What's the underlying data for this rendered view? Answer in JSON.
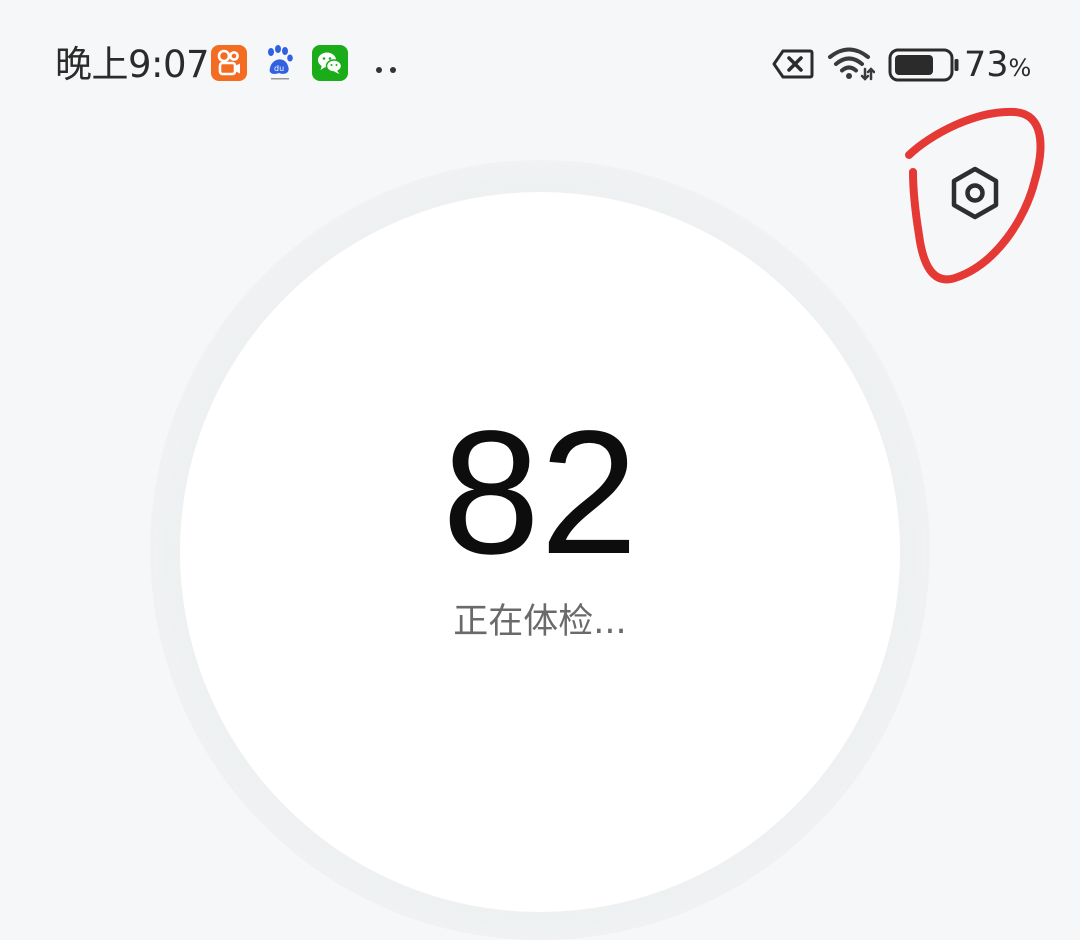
{
  "status_bar": {
    "time": "晚上9:07",
    "notification_icons": [
      "kuaishou-app-icon",
      "baidu-app-icon",
      "wechat-app-icon",
      "more-dots-icon"
    ],
    "system_icons": [
      "sim-error-icon",
      "wifi-icon",
      "battery-icon"
    ],
    "battery_level": 73,
    "battery_number": "73",
    "battery_unit": "%"
  },
  "header": {
    "settings_icon": "settings-hexagon-icon",
    "annotation_color": "#e53935"
  },
  "checkup": {
    "score": "82",
    "status": "正在体检..."
  },
  "colors": {
    "background": "#f6f7f8",
    "dial": "#ffffff",
    "score_text": "#0d0d0d",
    "status_text": "#6a6a6a"
  }
}
